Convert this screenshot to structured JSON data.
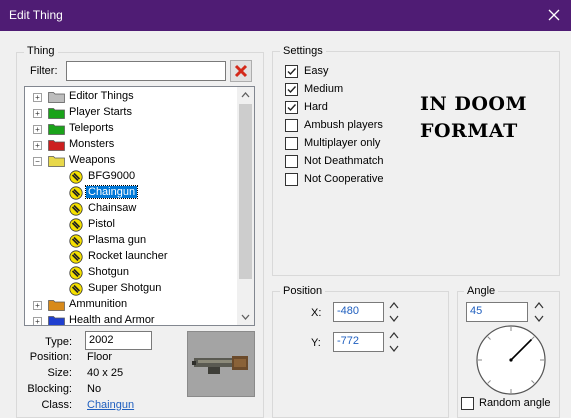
{
  "window": {
    "title": "Edit Thing"
  },
  "thing": {
    "group_label": "Thing",
    "filter_label": "Filter:",
    "filter_value": "",
    "tree": [
      {
        "label": "Editor Things",
        "expander": "+",
        "folder_color": "#bdbdbd",
        "depth": 0
      },
      {
        "label": "Player Starts",
        "expander": "+",
        "folder_color": "#1aa31a",
        "depth": 0
      },
      {
        "label": "Teleports",
        "expander": "+",
        "folder_color": "#1aa31a",
        "depth": 0
      },
      {
        "label": "Monsters",
        "expander": "+",
        "folder_color": "#cc1f1f",
        "depth": 0
      },
      {
        "label": "Weapons",
        "expander": "−",
        "folder_color": "#e8d84a",
        "depth": 0,
        "open": true
      },
      {
        "label": "BFG9000",
        "depth": 1
      },
      {
        "label": "Chaingun",
        "depth": 1,
        "selected": true
      },
      {
        "label": "Chainsaw",
        "depth": 1
      },
      {
        "label": "Pistol",
        "depth": 1
      },
      {
        "label": "Plasma gun",
        "depth": 1
      },
      {
        "label": "Rocket launcher",
        "depth": 1
      },
      {
        "label": "Shotgun",
        "depth": 1
      },
      {
        "label": "Super Shotgun",
        "depth": 1
      },
      {
        "label": "Ammunition",
        "expander": "+",
        "folder_color": "#d88a1a",
        "depth": 0
      },
      {
        "label": "Health and Armor",
        "expander": "+",
        "folder_color": "#1f3fcf",
        "depth": 0
      }
    ],
    "info": {
      "type_label": "Type:",
      "type_value": "2002",
      "position_label": "Position:",
      "position_value": "Floor",
      "size_label": "Size:",
      "size_value": "40 x 25",
      "blocking_label": "Blocking:",
      "blocking_value": "No",
      "class_label": "Class:",
      "class_value": "Chaingun"
    }
  },
  "settings": {
    "group_label": "Settings",
    "flags": [
      {
        "label": "Easy",
        "checked": true
      },
      {
        "label": "Medium",
        "checked": true
      },
      {
        "label": "Hard",
        "checked": true
      },
      {
        "label": "Ambush players",
        "checked": false
      },
      {
        "label": "Multiplayer only",
        "checked": false
      },
      {
        "label": "Not Deathmatch",
        "checked": false
      },
      {
        "label": "Not Cooperative",
        "checked": false
      }
    ],
    "format_note_line1": "IN DOOM",
    "format_note_line2": "FORMAT"
  },
  "position": {
    "group_label": "Position",
    "x_label": "X:",
    "x_value": "-480",
    "y_label": "Y:",
    "y_value": "-772"
  },
  "angle": {
    "group_label": "Angle",
    "value": "45",
    "random_label": "Random angle",
    "random_checked": false
  },
  "colors": {
    "titlebar": "#4f1c74",
    "selection": "#0078d7",
    "link": "#1f5fbf"
  }
}
